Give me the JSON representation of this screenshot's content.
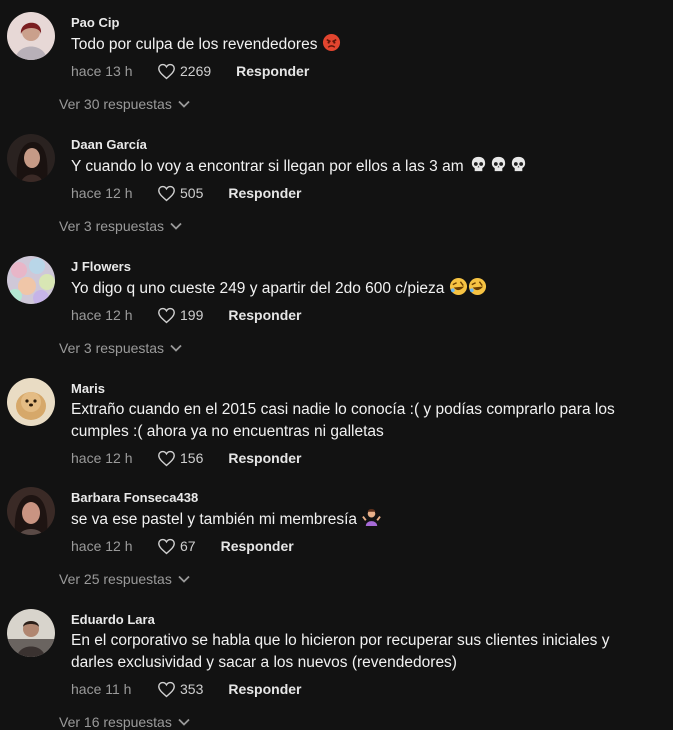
{
  "comments": [
    {
      "author": "Pao Cip",
      "text": "Todo por culpa de los revendedores",
      "time": "hace 13 h",
      "likes": "2269",
      "reply_label": "Responder",
      "replies_label": "Ver 30 respuestas",
      "emoji": "angry-face"
    },
    {
      "author": "Daan García",
      "text": "Y cuando lo voy a encontrar si llegan por ellos a las 3 am",
      "time": "hace 12 h",
      "likes": "505",
      "reply_label": "Responder",
      "replies_label": "Ver 3 respuestas",
      "emoji": "skull x3"
    },
    {
      "author": "J Flowers",
      "text": "Yo digo q uno cueste 249 y apartir del 2do 600 c/pieza",
      "time": "hace 12 h",
      "likes": "199",
      "reply_label": "Responder",
      "replies_label": "Ver 3 respuestas",
      "emoji": "rolling-on-floor-laughing x2"
    },
    {
      "author": "Maris",
      "text": "Extraño cuando en el 2015 casi nadie lo conocía :( y podías comprarlo para los cumples :( ahora ya no encuentras ni galletas",
      "time": "hace 12 h",
      "likes": "156",
      "reply_label": "Responder"
    },
    {
      "author": "Barbara Fonseca438",
      "text": "se va ese pastel y también mi membresía",
      "time": "hace 12 h",
      "likes": "67",
      "reply_label": "Responder",
      "replies_label": "Ver 25 respuestas",
      "emoji": "person-shrugging"
    },
    {
      "author": "Eduardo Lara",
      "text": "En el corporativo se habla que lo hicieron por recuperar sus clientes iniciales y darles exclusividad y sacar a los nuevos (revendedores)",
      "time": "hace 11 h",
      "likes": "353",
      "reply_label": "Responder",
      "replies_label": "Ver 16 respuestas"
    }
  ],
  "colors": {
    "background": "#121212",
    "text": "#f2f2f2",
    "muted": "#9a9a9a"
  }
}
